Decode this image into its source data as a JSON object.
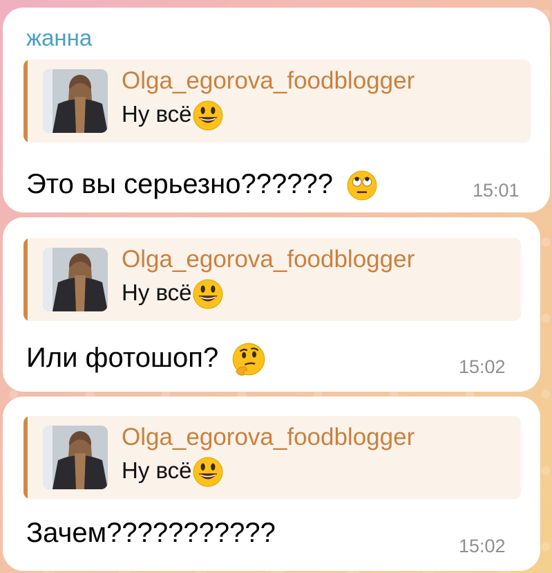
{
  "messages": [
    {
      "sender": "жанна",
      "reply": {
        "author": "Olga_egorova_foodblogger",
        "text": "Ну всё",
        "emoji": "grinning-face-emoji"
      },
      "text": "Это вы серьезно??????",
      "emoji": "face-with-rolling-eyes-emoji",
      "time": "15:01"
    },
    {
      "reply": {
        "author": "Olga_egorova_foodblogger",
        "text": "Ну всё",
        "emoji": "grinning-face-emoji"
      },
      "text": "Или фотошоп?",
      "emoji": "thinking-face-emoji",
      "time": "15:02"
    },
    {
      "reply": {
        "author": "Olga_egorova_foodblogger",
        "text": "Ну всё",
        "emoji": "grinning-face-emoji"
      },
      "text": "Зачем???????????",
      "time": "15:02"
    }
  ],
  "colors": {
    "sender": "#4a9fc2",
    "reply_author": "#c9813e",
    "reply_bar": "#d08a45",
    "reply_bg": "#fbf2ea",
    "time": "#8e8e93"
  }
}
